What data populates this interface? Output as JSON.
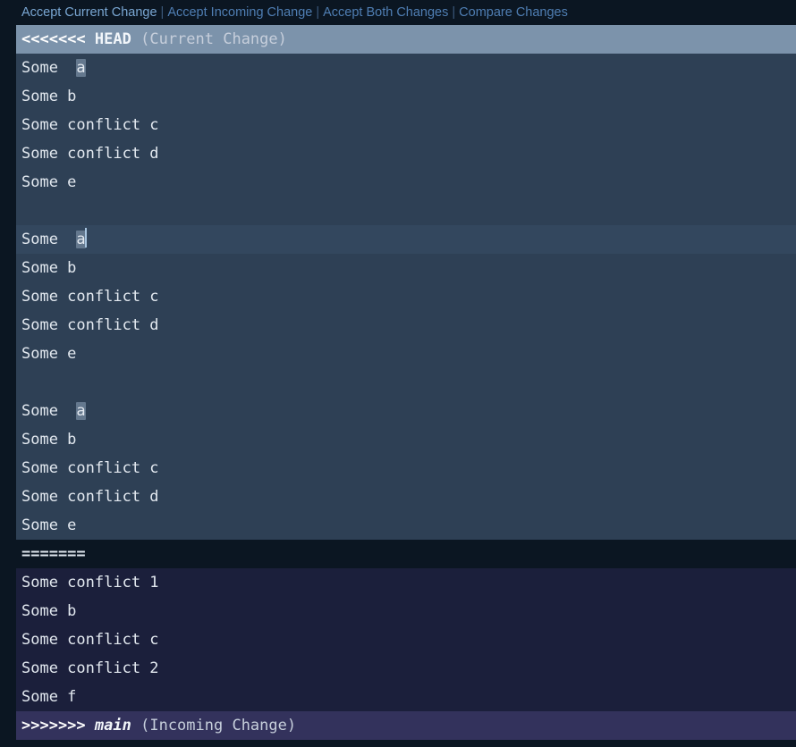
{
  "codelens": {
    "name": "merge-conflict-codelens",
    "separator": "|",
    "actions": [
      {
        "id": "accept-current-change",
        "label": "Accept Current Change",
        "primary": true
      },
      {
        "id": "accept-incoming-change",
        "label": "Accept Incoming Change",
        "primary": false
      },
      {
        "id": "accept-both-changes",
        "label": "Accept Both Changes",
        "primary": false
      },
      {
        "id": "compare-changes",
        "label": "Compare Changes",
        "primary": false
      }
    ]
  },
  "conflict": {
    "current_marker": {
      "arrows": "<<<<<<<",
      "ref": "HEAD",
      "note": "(Current Change)"
    },
    "separator_marker": {
      "equals": "======="
    },
    "incoming_marker": {
      "arrows": ">>>>>>>",
      "ref": "main",
      "note": "(Incoming Change)"
    }
  },
  "lines": [
    {
      "id": "l1",
      "region": "current-header",
      "kind": "marker-current"
    },
    {
      "id": "l2",
      "region": "current",
      "kind": "code",
      "prefix": "Some  ",
      "highlight": "a",
      "suffix": "",
      "caret": false
    },
    {
      "id": "l3",
      "region": "current",
      "kind": "code",
      "text": "Some b"
    },
    {
      "id": "l4",
      "region": "current",
      "kind": "code",
      "text": "Some conflict c"
    },
    {
      "id": "l5",
      "region": "current",
      "kind": "code",
      "text": "Some conflict d"
    },
    {
      "id": "l6",
      "region": "current",
      "kind": "code",
      "text": "Some e"
    },
    {
      "id": "l7",
      "region": "current",
      "kind": "code",
      "text": ""
    },
    {
      "id": "l8",
      "region": "current",
      "kind": "code",
      "prefix": "Some  ",
      "highlight": "a",
      "suffix": "",
      "caret": true,
      "current_line": true
    },
    {
      "id": "l9",
      "region": "current",
      "kind": "code",
      "text": "Some b"
    },
    {
      "id": "l10",
      "region": "current",
      "kind": "code",
      "text": "Some conflict c"
    },
    {
      "id": "l11",
      "region": "current",
      "kind": "code",
      "text": "Some conflict d"
    },
    {
      "id": "l12",
      "region": "current",
      "kind": "code",
      "text": "Some e"
    },
    {
      "id": "l13",
      "region": "current",
      "kind": "code",
      "text": ""
    },
    {
      "id": "l14",
      "region": "current",
      "kind": "code",
      "prefix": "Some  ",
      "highlight": "a",
      "suffix": "",
      "caret": false
    },
    {
      "id": "l15",
      "region": "current",
      "kind": "code",
      "text": "Some b"
    },
    {
      "id": "l16",
      "region": "current",
      "kind": "code",
      "text": "Some conflict c"
    },
    {
      "id": "l17",
      "region": "current",
      "kind": "code",
      "text": "Some conflict d"
    },
    {
      "id": "l18",
      "region": "current",
      "kind": "code",
      "text": "Some e"
    },
    {
      "id": "l19",
      "region": "separator",
      "kind": "marker-separator"
    },
    {
      "id": "l20",
      "region": "incoming",
      "kind": "code",
      "text": "Some conflict 1"
    },
    {
      "id": "l21",
      "region": "incoming",
      "kind": "code",
      "text": "Some b"
    },
    {
      "id": "l22",
      "region": "incoming",
      "kind": "code",
      "text": "Some conflict c"
    },
    {
      "id": "l23",
      "region": "incoming",
      "kind": "code",
      "text": "Some conflict 2"
    },
    {
      "id": "l24",
      "region": "incoming",
      "kind": "code",
      "text": "Some f"
    },
    {
      "id": "l25",
      "region": "incoming-footer",
      "kind": "marker-incoming"
    }
  ],
  "colors": {
    "editor_background": "#0b1622",
    "current_change_background": "#2e4055",
    "current_header_background": "#7c93ab",
    "incoming_change_background": "#1b1f3b",
    "incoming_footer_background": "#33325c",
    "current_line_background": "#33475e",
    "occurrence_highlight": "#64788e",
    "codelens_primary": "#79a6d2",
    "codelens_secondary": "#4f7eb3",
    "foreground": "#e3e9f0",
    "caret": "#a8c5e0"
  }
}
